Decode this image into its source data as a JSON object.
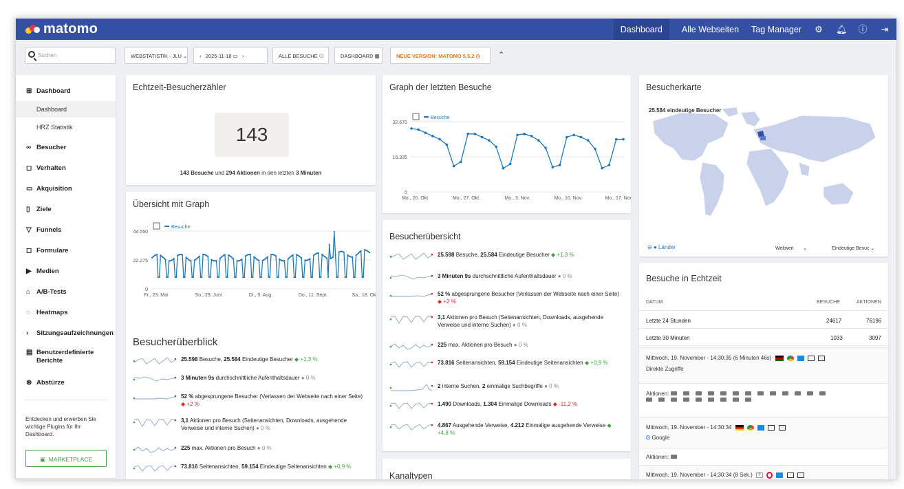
{
  "topbar": {
    "logo": "matomo",
    "nav": [
      "Dashboard",
      "Alle Webseiten",
      "Tag Manager"
    ]
  },
  "toolbar": {
    "search_placeholder": "Suchen",
    "site_selector": "WEBSTATISTIK - JLU",
    "date": "2025-11-18",
    "segment": "ALLE BESUCHE",
    "dashboard": "DASHBOARD",
    "new_version": "NEUE VERSION: MATOMO 5.5.2"
  },
  "sidebar": {
    "sections": [
      {
        "label": "Dashboard",
        "icon": "dashboard-icon"
      },
      {
        "label": "Besucher",
        "icon": "visitors-icon"
      },
      {
        "label": "Verhalten",
        "icon": "behaviour-icon"
      },
      {
        "label": "Akquisition",
        "icon": "acquisition-icon"
      },
      {
        "label": "Ziele",
        "icon": "goals-icon"
      },
      {
        "label": "Funnels",
        "icon": "funnel-icon"
      },
      {
        "label": "Formulare",
        "icon": "forms-icon"
      },
      {
        "label": "Medien",
        "icon": "media-icon"
      },
      {
        "label": "A/B-Tests",
        "icon": "ab-test-icon"
      },
      {
        "label": "Heatmaps",
        "icon": "heatmap-icon"
      },
      {
        "label": "Sitzungsaufzeichnungen",
        "icon": "chevron-right-icon"
      },
      {
        "label": "Benutzerdefinierte Berichte",
        "icon": "custom-reports-icon"
      },
      {
        "label": "Abstürze",
        "icon": "crash-icon"
      }
    ],
    "subitems": [
      "Dashboard",
      "HRZ Statistik"
    ],
    "plugin_text": "Entdecken und erwerben Sie wichtige Plugins für Ihr Dashboard.",
    "marketplace": "MARKETPLACE"
  },
  "realtime_counter": {
    "title": "Echtzeit-Besucherzähler",
    "count": "143",
    "visits": "143 Besuche",
    "und": "und",
    "actions": "294 Aktionen",
    "in_last": "in den letzten",
    "minutes": "3 Minuten"
  },
  "overview_graph": {
    "title": "Übersicht mit Graph",
    "legend": "Besuche",
    "chart_data": {
      "type": "line",
      "title": "",
      "series": [
        {
          "name": "Besuche"
        }
      ],
      "ylim": [
        0,
        44550
      ],
      "yticks": [
        "44.550",
        "22.275",
        "0"
      ],
      "xticks": [
        "Fr., 23. Mai",
        "So., 29. Juni",
        "Di., 5. Aug.",
        "Do., 11. Sept.",
        "Sa., 18. Okt."
      ]
    }
  },
  "last_visits_graph": {
    "title": "Graph der letzten Besuche",
    "legend": "Besuche",
    "chart_data": {
      "type": "line",
      "title": "",
      "series": [
        {
          "name": "Besuche",
          "values": [
            29500,
            29000,
            27500,
            26000,
            24500,
            22000,
            12000,
            14000,
            27000,
            27000,
            25500,
            24000,
            21000,
            11000,
            13000,
            26500,
            27000,
            26000,
            24000,
            20500,
            11500,
            12500,
            25500,
            26500,
            25500,
            24000,
            20000,
            11000,
            12500,
            24500,
            24500
          ]
        }
      ],
      "ylim": [
        0,
        32670
      ],
      "yticks": [
        "32.670",
        "16.335",
        "0"
      ],
      "xticks": [
        "Mo., 20. Okt.",
        "Mo., 27. Okt.",
        "Mo., 3. Nov.",
        "Mo., 10. Nov.",
        "Mo., 17. Nov."
      ]
    }
  },
  "visitor_map": {
    "title": "Besucherkarte",
    "unique_visitors": "25.584 eindeutige Besucher",
    "countries_link": "Länder",
    "region": "Weltweit",
    "metric": "Eindeutige Besuc"
  },
  "visitor_summary": {
    "title": "Besucherübersicht",
    "rows": [
      {
        "bold": "25.598",
        "text": " Besuche, ",
        "bold2": "25.584",
        "text2": " Eindeutige Besucher",
        "change": "+1,3 %",
        "trend": "pos"
      },
      {
        "bold": "3 Minuten 9s",
        "text": " durchschnittliche Aufenthaltsdauer",
        "bold2": "",
        "text2": "",
        "change": "0 %",
        "trend": "neu"
      },
      {
        "bold": "52 %",
        "text": " abgesprungene Besucher (Verlassen der Webseite nach einer Seite)",
        "bold2": "",
        "text2": "",
        "change": "+2 %",
        "trend": "neg"
      },
      {
        "bold": "3,1",
        "text": " Aktionen pro Besuch (Seitenansichten, Downloads, ausgehende Verweise und interne Suchen)",
        "bold2": "",
        "text2": "",
        "change": "0 %",
        "trend": "neu"
      },
      {
        "bold": "225",
        "text": " max. Aktionen pro Besuch",
        "bold2": "",
        "text2": "",
        "change": "0 %",
        "trend": "neu"
      },
      {
        "bold": "73.816",
        "text": " Seitenansichten, ",
        "bold2": "59.154",
        "text2": " Eindeutige Seitenansichten",
        "change": "+0,9 %",
        "trend": "pos"
      },
      {
        "bold": "2",
        "text": " interne Suchen, ",
        "bold2": "2",
        "text2": " einmalige Suchbegriffe",
        "change": "0 %",
        "trend": "neu"
      },
      {
        "bold": "1.490",
        "text": " Downloads, ",
        "bold2": "1.304",
        "text2": " Einmalige Downloads",
        "change": "-11,2 %",
        "trend": "neg"
      },
      {
        "bold": "4.867",
        "text": " Ausgehende Verweise, ",
        "bold2": "4.212",
        "text2": " Einmalige ausgehende Verweise",
        "change": "+4,8 %",
        "trend": "pos"
      }
    ]
  },
  "visitor_overview": {
    "title": "Besucherüberblick"
  },
  "channel_types": {
    "title": "Kanaltypen"
  },
  "realtime_visits": {
    "title": "Besuche in Echtzeit",
    "headers": [
      "DATUM",
      "BESUCHE",
      "AKTIONEN"
    ],
    "rows": [
      {
        "label": "Letzte 24 Stunden",
        "visits": "24617",
        "actions": "76196"
      },
      {
        "label": "Letzte 30 Minuten",
        "visits": "1033",
        "actions": "3097"
      }
    ],
    "visits": [
      {
        "time": "Mittwoch, 19. November - 14:30:35 (6 Minuten 46s)",
        "source": "Direkte Zugriffe",
        "actions_label": "Aktionen:"
      },
      {
        "time": "Mittwoch, 19. November - 14:30:34",
        "source": "Google",
        "actions_label": "Aktionen:"
      },
      {
        "time": "Mittwoch, 19. November - 14:30:34 (8 Sek.)"
      }
    ]
  },
  "colors": {
    "header": "#3450a3",
    "accent": "#1f78b4",
    "positive": "#43a047",
    "negative": "#d32f2f",
    "orange": "#e07c12"
  }
}
